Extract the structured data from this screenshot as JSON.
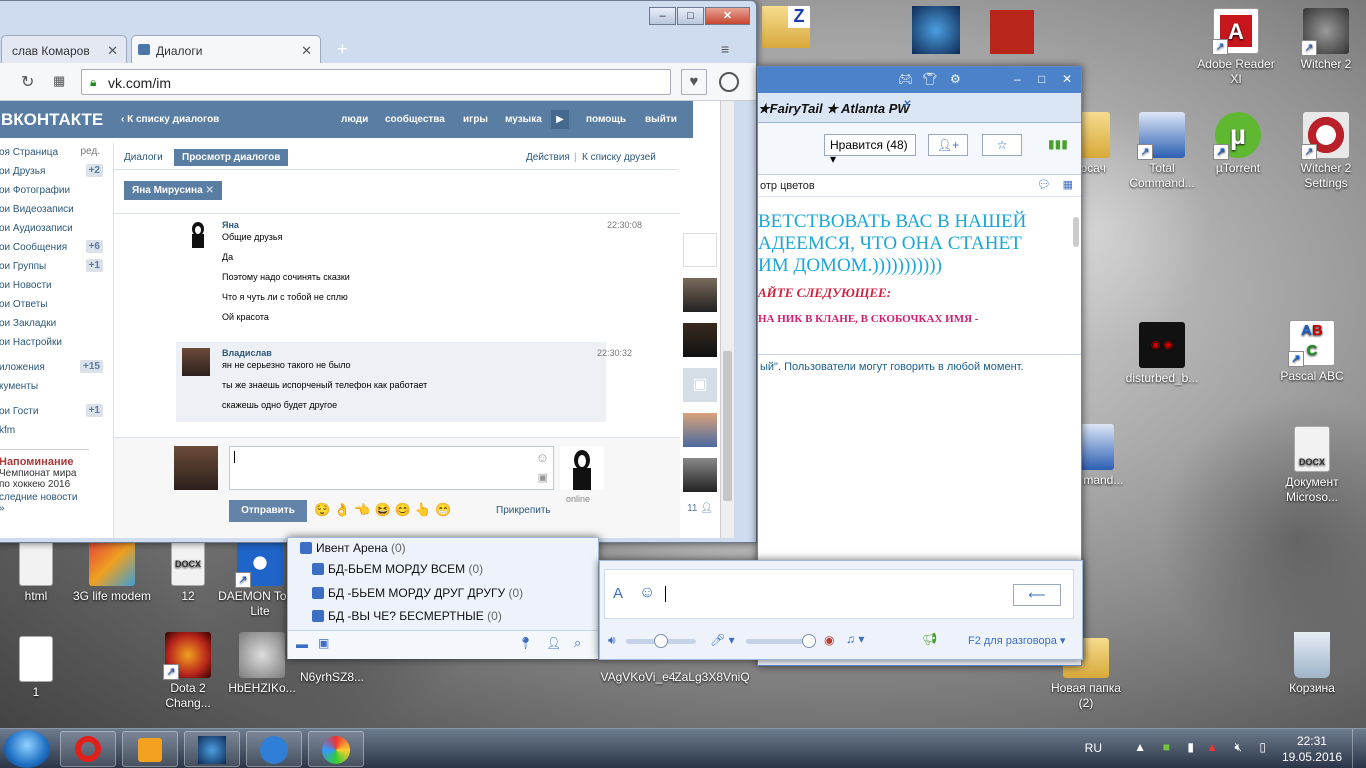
{
  "chrome": {
    "tabs": [
      {
        "label": "слав Комаров"
      },
      {
        "label": "Диалоги"
      }
    ],
    "url": "vk.com/im",
    "win_min": "‒",
    "win_max": "□",
    "win_close": "✕"
  },
  "vk": {
    "logo": "ВКОНТАКТЕ",
    "back": "К списку диалогов",
    "nav": [
      "люди",
      "сообщества",
      "игры",
      "музыка",
      "помощь",
      "выйти"
    ],
    "left_menu": [
      {
        "label": "оя Страница",
        "count": "ред."
      },
      {
        "label": "ои Друзья",
        "count": "+2"
      },
      {
        "label": "ои Фотографии",
        "count": ""
      },
      {
        "label": "ои Видеозаписи",
        "count": ""
      },
      {
        "label": "ои Аудиозаписи",
        "count": ""
      },
      {
        "label": "ои Сообщения",
        "count": "+6"
      },
      {
        "label": "ои Группы",
        "count": "+1"
      },
      {
        "label": "ои Новости",
        "count": ""
      },
      {
        "label": "ои Ответы",
        "count": ""
      },
      {
        "label": "ои Закладки",
        "count": ""
      },
      {
        "label": "ои Настройки",
        "count": ""
      },
      {
        "label": "иложения",
        "count": "+15"
      },
      {
        "label": "кументы",
        "count": ""
      },
      {
        "label": "ои Гости",
        "count": "+1"
      },
      {
        "label": "kfm",
        "count": ""
      }
    ],
    "reminder": {
      "title": "Напоминание",
      "line1": "Чемпионат мира",
      "line2": "по хоккею 2016",
      "link": "следние новости »"
    },
    "tabs": {
      "dialogs": "Диалоги",
      "view": "Просмотр диалогов",
      "actions": "Действия",
      "friends": "К списку друзей"
    },
    "peer": "Яна Мирусина",
    "messages": [
      {
        "name": "Яна",
        "time": "22:30:08",
        "lines": [
          "Общие друзья",
          "Да",
          "Поэтому надо сочинять сказки",
          "Что я чуть ли с тобой не сплю",
          "Ой красота"
        ]
      },
      {
        "name": "Владислав",
        "time": "22:30:32",
        "lines": [
          "ян не серьезно такого не было",
          "ты же знаешь испорченый телефон как работает",
          "скажешь одно будет другое"
        ]
      }
    ],
    "send": "Отправить",
    "attach": "Прикрепить",
    "online": "online",
    "members": "11"
  },
  "game": {
    "tab": "★FairyTail ★ Atlanta PW",
    "likes": "Нравится (48)",
    "subbar": "отр цветов",
    "motd_lines": [
      "ВЕТСТВОВАТЬ ВАС В НАШЕЙ",
      "АДЕЕМСЯ, ЧТО ОНА СТАНЕТ",
      "ИМ ДОМОМ.)))))))))))"
    ],
    "motd_red": "АЙТЕ СЛЕДУЮЩЕЕ:",
    "motd_pink": "НА НИК В КЛАНЕ, В СКОБОЧКАХ ИМЯ -",
    "chat_note": "ый\". Пользователи могут говорить в любой момент.",
    "f2": "F2 для разговора",
    "groups": [
      {
        "label": "Ивент Арена",
        "count": "(0)"
      },
      {
        "label": "БД-БЬЕМ МОРДУ ВСЕМ",
        "count": "(0)"
      },
      {
        "label": "БД -БЬЕМ МОРДУ ДРУГ ДРУГУ",
        "count": "(0)"
      },
      {
        "label": "БД -ВЫ ЧЕ? БЕСМЕРТНЫЕ",
        "count": "(0)"
      }
    ]
  },
  "desktop_icons": [
    {
      "label": "Adobe Reader XI",
      "color": "#c8161d"
    },
    {
      "label": "Witcher 2",
      "color": "#3a3a3a"
    },
    {
      "label": "Total Command...",
      "color": "#2c5fb3"
    },
    {
      "label": "µTorrent",
      "color": "#5fb832"
    },
    {
      "label": "Witcher 2 Settings",
      "color": "#b8202a"
    },
    {
      "label": "disturbed_b...",
      "color": "#111111"
    },
    {
      "label": "Pascal ABC",
      "color": "#ffffff"
    },
    {
      "label": "Документ Microso...",
      "color": "#f2f2f2"
    },
    {
      "label": "Корзина",
      "color": "#c9d7e4"
    },
    {
      "label": "Новая папка (2)",
      "color": "#e8c66a"
    },
    {
      "label": "html",
      "color": "#f2f2f2"
    },
    {
      "label": "3G life modem",
      "color": "#e0443b"
    },
    {
      "label": "12",
      "color": "#f2f2f2"
    },
    {
      "label": "DAEMON Tools Lite",
      "color": "#1f65c9"
    },
    {
      "label": "1",
      "color": "#ffffff"
    },
    {
      "label": "Dota 2 Chang...",
      "color": "#b8251b"
    },
    {
      "label": "HbEHZIKo...",
      "color": "#7a7a7a"
    },
    {
      "label": "N6yrhSZ8...",
      "color": "#555555"
    },
    {
      "label": "VAgVKoVi_e4",
      "color": "#666666"
    },
    {
      "label": "ZaLg3X8VniQ",
      "color": "#666666"
    },
    {
      "label": "otal mand...",
      "color": "#2c5fb3"
    },
    {
      "label": "юсач",
      "color": "#e8c66a"
    }
  ],
  "taskbar": {
    "lang": "RU",
    "time": "22:31",
    "date": "19.05.2016"
  }
}
